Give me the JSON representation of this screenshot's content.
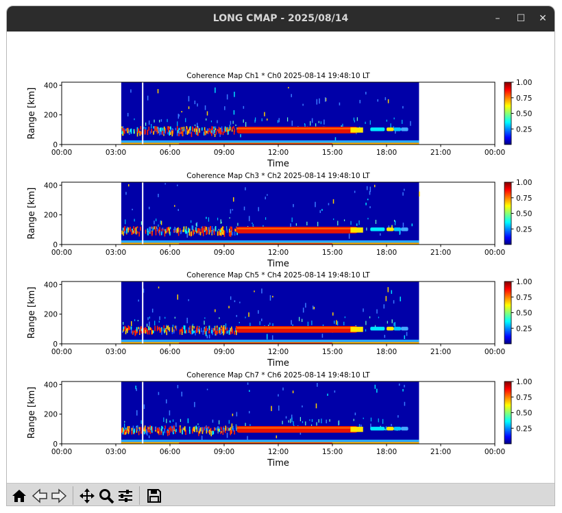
{
  "window": {
    "title": "LONG CMAP - 2025/08/14",
    "controls": {
      "minimize": "–",
      "maximize": "☐",
      "close": "✕"
    }
  },
  "toolbar": {
    "buttons": [
      "home-icon",
      "back-icon",
      "forward-icon",
      "pan-icon",
      "zoom-icon",
      "configure-subplots-icon",
      "save-icon"
    ]
  },
  "colormap": {
    "name": "jet",
    "stops": [
      "#000080",
      "#0000ff",
      "#00ffff",
      "#ffff00",
      "#ff0000",
      "#800000"
    ]
  },
  "chart_data": [
    {
      "type": "heatmap",
      "title": "Coherence Map Ch1 * Ch0 2025-08-14 19:48:10 LT",
      "xlabel": "Time",
      "ylabel": "Range [km]",
      "xticks": [
        "00:00",
        "03:00",
        "06:00",
        "09:00",
        "12:00",
        "15:00",
        "18:00",
        "21:00",
        "00:00"
      ],
      "xlim_hours": [
        0,
        24
      ],
      "yticks": [
        "0",
        "200",
        "400"
      ],
      "ylim": [
        0,
        420
      ],
      "data_coverage_hours": [
        3.3,
        19.8
      ],
      "colorbar": {
        "ticks": [
          "0.25",
          "0.50",
          "0.75",
          "1.00"
        ],
        "range": [
          0,
          1
        ]
      }
    },
    {
      "type": "heatmap",
      "title": "Coherence Map Ch3 * Ch2 2025-08-14 19:48:10 LT",
      "xlabel": "Time",
      "ylabel": "Range [km]",
      "xticks": [
        "00:00",
        "03:00",
        "06:00",
        "09:00",
        "12:00",
        "15:00",
        "18:00",
        "21:00",
        "00:00"
      ],
      "xlim_hours": [
        0,
        24
      ],
      "yticks": [
        "0",
        "200",
        "400"
      ],
      "ylim": [
        0,
        420
      ],
      "data_coverage_hours": [
        3.3,
        19.8
      ],
      "colorbar": {
        "ticks": [
          "0.25",
          "0.50",
          "0.75",
          "1.00"
        ],
        "range": [
          0,
          1
        ]
      }
    },
    {
      "type": "heatmap",
      "title": "Coherence Map Ch5 * Ch4 2025-08-14 19:48:10 LT",
      "xlabel": "Time",
      "ylabel": "Range [km]",
      "xticks": [
        "00:00",
        "03:00",
        "06:00",
        "09:00",
        "12:00",
        "15:00",
        "18:00",
        "21:00",
        "00:00"
      ],
      "xlim_hours": [
        0,
        24
      ],
      "yticks": [
        "0",
        "200",
        "400"
      ],
      "ylim": [
        0,
        420
      ],
      "data_coverage_hours": [
        3.3,
        19.8
      ],
      "colorbar": {
        "ticks": [
          "0.25",
          "0.50",
          "0.75",
          "1.00"
        ],
        "range": [
          0,
          1
        ]
      }
    },
    {
      "type": "heatmap",
      "title": "Coherence Map Ch7 * Ch6 2025-08-14 19:48:10 LT",
      "xlabel": "Time",
      "ylabel": "Range [km]",
      "xticks": [
        "00:00",
        "03:00",
        "06:00",
        "09:00",
        "12:00",
        "15:00",
        "18:00",
        "21:00",
        "00:00"
      ],
      "xlim_hours": [
        0,
        24
      ],
      "yticks": [
        "0",
        "200",
        "400"
      ],
      "ylim": [
        0,
        420
      ],
      "data_coverage_hours": [
        3.3,
        19.8
      ],
      "colorbar": {
        "ticks": [
          "0.25",
          "0.50",
          "0.75",
          "1.00"
        ],
        "range": [
          0,
          1
        ]
      }
    }
  ]
}
